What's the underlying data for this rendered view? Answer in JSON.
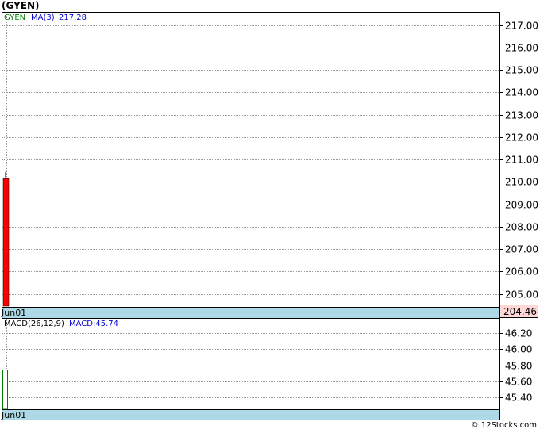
{
  "title": "(GYEN)",
  "footer": "© 12Stocks.com",
  "colors": {
    "grid": "#9a9a9a",
    "date_bar": "#add8e6",
    "candle_down": "#ff0000",
    "legend_symbol": "#008000",
    "legend_ma": "#0000cd",
    "macd_bar": "#008000",
    "price_label_box": "#ffd7d7"
  },
  "price_panel": {
    "legend_symbol": "GYEN",
    "legend_ma": "MA(3)",
    "legend_ma_value": "217.28",
    "date_label": "Jun01",
    "last_price_label": "204.46"
  },
  "macd_panel": {
    "legend_label": "MACD(26,12,9)",
    "legend_value": "MACD:45.74",
    "date_label": "Jun01"
  },
  "chart_data": [
    {
      "type": "candlestick",
      "y_axis_side": "right",
      "ylim": [
        204.46,
        217.55
      ],
      "y_ticks": [
        "205.00",
        "206.00",
        "207.00",
        "208.00",
        "209.00",
        "210.00",
        "211.00",
        "212.00",
        "213.00",
        "214.00",
        "215.00",
        "216.00",
        "217.00"
      ],
      "x": [
        "Jun01"
      ],
      "candles": [
        {
          "date": "Jun01",
          "open": 210.15,
          "high": 210.45,
          "low": 204.46,
          "close": 204.46
        }
      ],
      "grid": true
    },
    {
      "type": "bar",
      "name": "MACD",
      "y_axis_side": "right",
      "ylim": [
        45.25,
        46.38
      ],
      "y_ticks": [
        "45.40",
        "45.60",
        "45.80",
        "46.00",
        "46.20"
      ],
      "x": [
        "Jun01"
      ],
      "values": [
        45.74
      ],
      "grid": true
    }
  ]
}
